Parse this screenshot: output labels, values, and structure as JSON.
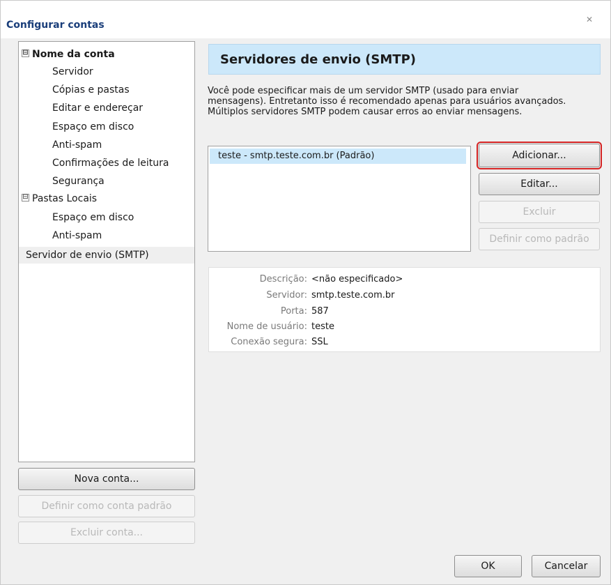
{
  "window": {
    "title": "Configurar contas",
    "close_icon": "close-icon"
  },
  "tree": {
    "items": [
      {
        "label": "Nome da conta",
        "level": 0,
        "expander": "⊟",
        "bold": true
      },
      {
        "label": "Servidor",
        "level": 1
      },
      {
        "label": "Cópias e pastas",
        "level": 1
      },
      {
        "label": "Editar e endereçar",
        "level": 1
      },
      {
        "label": "Espaço em disco",
        "level": 1
      },
      {
        "label": "Anti-spam",
        "level": 1
      },
      {
        "label": "Confirmações de leitura",
        "level": 1
      },
      {
        "label": "Segurança",
        "level": 1
      },
      {
        "label": "Pastas Locais",
        "level": 0,
        "expander": "⊟"
      },
      {
        "label": "Espaço em disco",
        "level": 1
      },
      {
        "label": "Anti-spam",
        "level": 1
      },
      {
        "label": "Servidor de envio (SMTP)",
        "level": 0,
        "selected": true
      }
    ]
  },
  "account_buttons": {
    "new_account": "Nova conta...",
    "set_default": "Definir como conta padrão",
    "delete_account": "Excluir conta..."
  },
  "panel": {
    "header": "Servidores de envio (SMTP)",
    "description": "Você pode especificar mais de um servidor SMTP (usado para enviar mensagens). Entretanto isso é recomendado apenas para usuários avançados. Múltiplos servidores SMTP podem causar erros ao enviar mensagens.",
    "servers": [
      "teste - smtp.teste.com.br (Padrão)"
    ],
    "buttons": {
      "add": "Adicionar...",
      "edit": "Editar...",
      "delete": "Excluir",
      "set_default": "Definir como padrão"
    },
    "details": [
      {
        "label": "Descrição:",
        "value": "<não especificado>"
      },
      {
        "label": "Servidor:",
        "value": "smtp.teste.com.br"
      },
      {
        "label": "Porta:",
        "value": "587"
      },
      {
        "label": "Nome de usuário:",
        "value": "teste"
      },
      {
        "label": "Conexão segura:",
        "value": "SSL"
      }
    ]
  },
  "footer": {
    "ok": "OK",
    "cancel": "Cancelar"
  },
  "colors": {
    "header_bg": "#cce8fa",
    "selection_bg": "#cce8fa",
    "highlight_outline": "#d42323",
    "title_color": "#1a3e7a"
  }
}
